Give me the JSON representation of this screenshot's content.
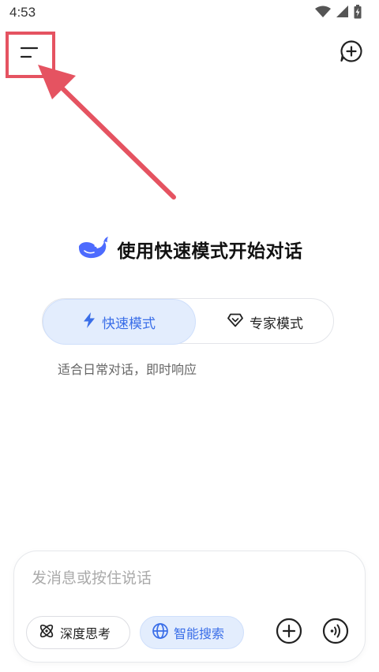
{
  "status_bar": {
    "time": "4:53",
    "icons": [
      "wifi-icon",
      "signal-icon",
      "battery-icon"
    ]
  },
  "top_bar": {
    "menu_icon": "menu-icon",
    "new_chat_icon": "new-chat-icon"
  },
  "hero": {
    "logo": "whale-logo-icon",
    "title": "使用快速模式开始对话"
  },
  "modes": {
    "quick_label": "快速模式",
    "expert_label": "专家模式",
    "selected": "quick",
    "description": "适合日常对话，即时响应"
  },
  "composer": {
    "placeholder": "发消息或按住说话",
    "deep_think_label": "深度思考",
    "search_label": "智能搜索",
    "attach_icon": "plus-circle-icon",
    "voice_icon": "voice-icon"
  },
  "colors": {
    "accent": "#3a6ee8",
    "accent_bg": "#e3edfd",
    "annotation": "#e55361",
    "logo": "#4d6bfe"
  }
}
